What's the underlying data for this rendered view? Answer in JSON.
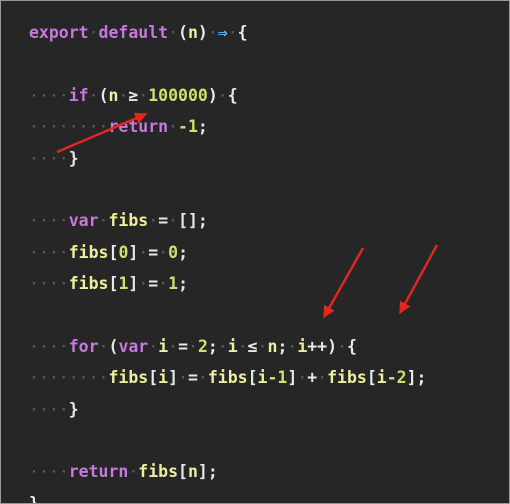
{
  "code": {
    "lines": [
      [
        {
          "t": "export",
          "c": "kw"
        },
        {
          "t": "·",
          "c": "ws"
        },
        {
          "t": "default",
          "c": "kw"
        },
        {
          "t": "·",
          "c": "ws"
        },
        {
          "t": "(",
          "c": "punc"
        },
        {
          "t": "n",
          "c": "var"
        },
        {
          "t": ")",
          "c": "punc"
        },
        {
          "t": "·",
          "c": "ws"
        },
        {
          "t": "⇒",
          "c": "fn"
        },
        {
          "t": "·",
          "c": "ws"
        },
        {
          "t": "{",
          "c": "punc"
        }
      ],
      [],
      [
        {
          "t": "····",
          "c": "ws"
        },
        {
          "t": "if",
          "c": "kw"
        },
        {
          "t": "·",
          "c": "ws"
        },
        {
          "t": "(",
          "c": "punc"
        },
        {
          "t": "n",
          "c": "var"
        },
        {
          "t": "·",
          "c": "ws"
        },
        {
          "t": "≥",
          "c": "punc"
        },
        {
          "t": "·",
          "c": "ws"
        },
        {
          "t": "100000",
          "c": "num"
        },
        {
          "t": ")",
          "c": "punc"
        },
        {
          "t": "·",
          "c": "ws"
        },
        {
          "t": "{",
          "c": "punc"
        }
      ],
      [
        {
          "t": "········",
          "c": "ws"
        },
        {
          "t": "return",
          "c": "kw"
        },
        {
          "t": "·",
          "c": "ws"
        },
        {
          "t": "-1",
          "c": "num"
        },
        {
          "t": ";",
          "c": "punc"
        }
      ],
      [
        {
          "t": "····",
          "c": "ws"
        },
        {
          "t": "}",
          "c": "punc"
        }
      ],
      [],
      [
        {
          "t": "····",
          "c": "ws"
        },
        {
          "t": "var",
          "c": "kw"
        },
        {
          "t": "·",
          "c": "ws"
        },
        {
          "t": "fibs",
          "c": "var"
        },
        {
          "t": "·",
          "c": "ws"
        },
        {
          "t": "=",
          "c": "punc"
        },
        {
          "t": "·",
          "c": "ws"
        },
        {
          "t": "[];",
          "c": "punc"
        }
      ],
      [
        {
          "t": "····",
          "c": "ws"
        },
        {
          "t": "fibs",
          "c": "var"
        },
        {
          "t": "[",
          "c": "punc"
        },
        {
          "t": "0",
          "c": "num"
        },
        {
          "t": "]",
          "c": "punc"
        },
        {
          "t": "·",
          "c": "ws"
        },
        {
          "t": "=",
          "c": "punc"
        },
        {
          "t": "·",
          "c": "ws"
        },
        {
          "t": "0",
          "c": "num"
        },
        {
          "t": ";",
          "c": "punc"
        }
      ],
      [
        {
          "t": "····",
          "c": "ws"
        },
        {
          "t": "fibs",
          "c": "var"
        },
        {
          "t": "[",
          "c": "punc"
        },
        {
          "t": "1",
          "c": "num"
        },
        {
          "t": "]",
          "c": "punc"
        },
        {
          "t": "·",
          "c": "ws"
        },
        {
          "t": "=",
          "c": "punc"
        },
        {
          "t": "·",
          "c": "ws"
        },
        {
          "t": "1",
          "c": "num"
        },
        {
          "t": ";",
          "c": "punc"
        }
      ],
      [],
      [
        {
          "t": "····",
          "c": "ws"
        },
        {
          "t": "for",
          "c": "kw"
        },
        {
          "t": "·",
          "c": "ws"
        },
        {
          "t": "(",
          "c": "punc"
        },
        {
          "t": "var",
          "c": "kw"
        },
        {
          "t": "·",
          "c": "ws"
        },
        {
          "t": "i",
          "c": "var"
        },
        {
          "t": "·",
          "c": "ws"
        },
        {
          "t": "=",
          "c": "punc"
        },
        {
          "t": "·",
          "c": "ws"
        },
        {
          "t": "2",
          "c": "num"
        },
        {
          "t": ";",
          "c": "punc"
        },
        {
          "t": "·",
          "c": "ws"
        },
        {
          "t": "i",
          "c": "var"
        },
        {
          "t": "·",
          "c": "ws"
        },
        {
          "t": "≤",
          "c": "punc"
        },
        {
          "t": "·",
          "c": "ws"
        },
        {
          "t": "n",
          "c": "var"
        },
        {
          "t": ";",
          "c": "punc"
        },
        {
          "t": "·",
          "c": "ws"
        },
        {
          "t": "i",
          "c": "var"
        },
        {
          "t": "++",
          "c": "punc"
        },
        {
          "t": ")",
          "c": "punc"
        },
        {
          "t": "·",
          "c": "ws"
        },
        {
          "t": "{",
          "c": "punc"
        }
      ],
      [
        {
          "t": "········",
          "c": "ws"
        },
        {
          "t": "fibs",
          "c": "var"
        },
        {
          "t": "[",
          "c": "punc"
        },
        {
          "t": "i",
          "c": "var"
        },
        {
          "t": "]",
          "c": "punc"
        },
        {
          "t": "·",
          "c": "ws"
        },
        {
          "t": "=",
          "c": "punc"
        },
        {
          "t": "·",
          "c": "ws"
        },
        {
          "t": "fibs",
          "c": "var"
        },
        {
          "t": "[",
          "c": "punc"
        },
        {
          "t": "i",
          "c": "var"
        },
        {
          "t": "-1",
          "c": "num"
        },
        {
          "t": "]",
          "c": "punc"
        },
        {
          "t": "·",
          "c": "ws"
        },
        {
          "t": "+",
          "c": "punc"
        },
        {
          "t": "·",
          "c": "ws"
        },
        {
          "t": "fibs",
          "c": "var"
        },
        {
          "t": "[",
          "c": "punc"
        },
        {
          "t": "i",
          "c": "var"
        },
        {
          "t": "-2",
          "c": "num"
        },
        {
          "t": "];",
          "c": "punc"
        }
      ],
      [
        {
          "t": "····",
          "c": "ws"
        },
        {
          "t": "}",
          "c": "punc"
        }
      ],
      [],
      [
        {
          "t": "····",
          "c": "ws"
        },
        {
          "t": "return",
          "c": "kw"
        },
        {
          "t": "·",
          "c": "ws"
        },
        {
          "t": "fibs",
          "c": "var"
        },
        {
          "t": "[",
          "c": "punc"
        },
        {
          "t": "n",
          "c": "var"
        },
        {
          "t": "];",
          "c": "punc"
        }
      ],
      [
        {
          "t": "}",
          "c": "punc"
        }
      ]
    ]
  },
  "annotation": {
    "arrow_color": "#e3261f",
    "arrow_count": 3
  }
}
